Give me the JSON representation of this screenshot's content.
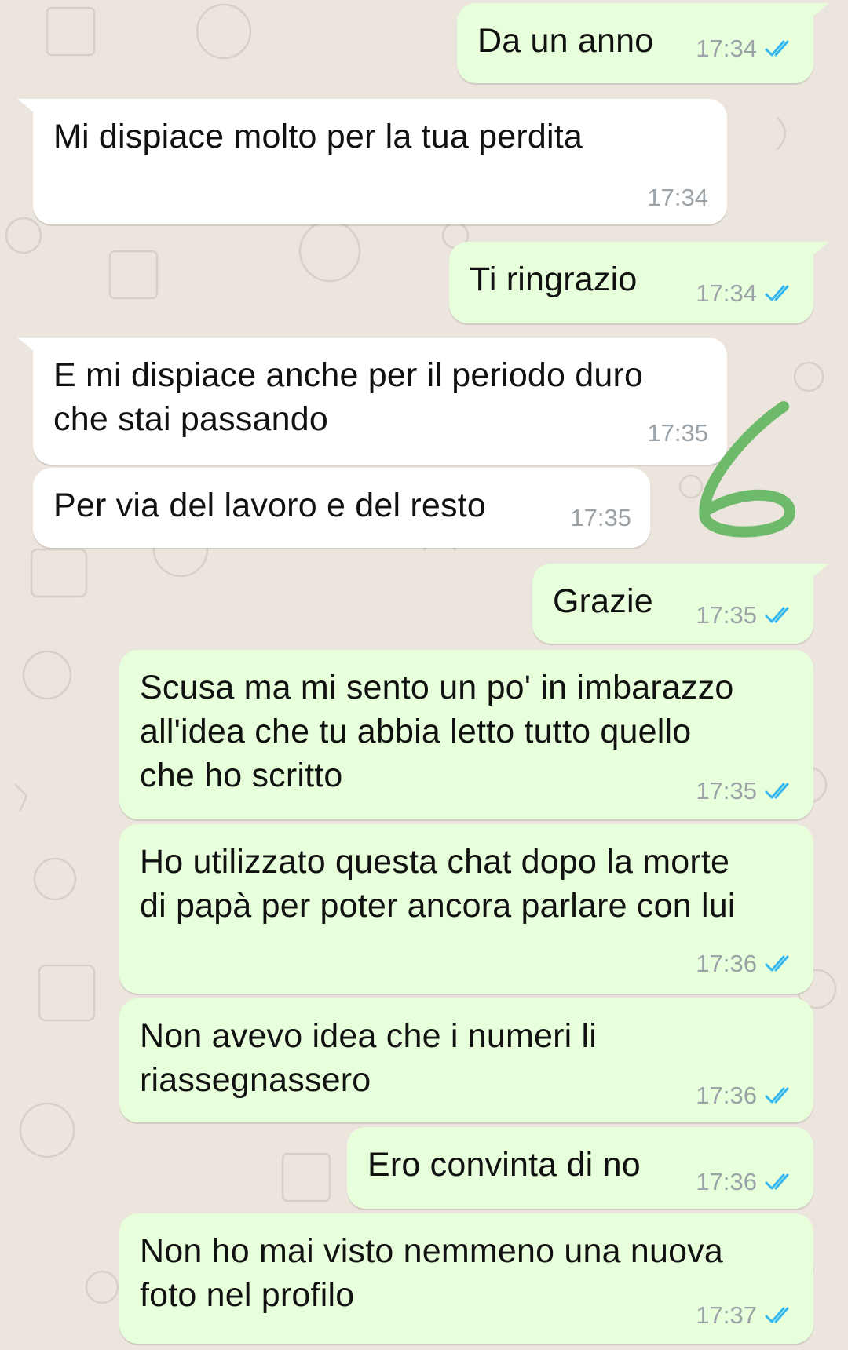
{
  "messages": [
    {
      "direction": "out",
      "text": "Da un anno",
      "time": "17:34",
      "status": "read"
    },
    {
      "direction": "in",
      "text": "Mi dispiace molto per la tua perdita",
      "time": "17:34"
    },
    {
      "direction": "out",
      "text": "Ti ringrazio",
      "time": "17:34",
      "status": "read"
    },
    {
      "direction": "in",
      "text": "E mi dispiace anche per il periodo duro\nche stai passando",
      "time": "17:35"
    },
    {
      "direction": "in",
      "text": "Per via del lavoro e del resto",
      "time": "17:35"
    },
    {
      "direction": "out",
      "text": "Grazie",
      "time": "17:35",
      "status": "read"
    },
    {
      "direction": "out",
      "text": "Scusa ma mi sento un po' in imbarazzo\nall'idea che tu abbia letto tutto quello\nche ho scritto",
      "time": "17:35",
      "status": "read"
    },
    {
      "direction": "out",
      "text": "Ho utilizzato questa chat dopo la morte\ndi papà per poter ancora parlare con lui",
      "time": "17:36",
      "status": "read"
    },
    {
      "direction": "out",
      "text": "Non avevo idea che i numeri li\nriassegnassero",
      "time": "17:36",
      "status": "read"
    },
    {
      "direction": "out",
      "text": "Ero convinta di no",
      "time": "17:36",
      "status": "read"
    },
    {
      "direction": "out",
      "text": "Non ho mai visto nemmeno una nuova\nfoto nel profilo",
      "time": "17:37",
      "status": "read"
    }
  ],
  "annotation": {
    "text": "6",
    "color": "#6DBA6A"
  },
  "colors": {
    "outgoing": "#E7FFDB",
    "incoming": "#FFFFFF",
    "read_ticks": "#34B7F1",
    "timestamp": "#9BA3A8",
    "wallpaper": "#ECE5DD"
  }
}
